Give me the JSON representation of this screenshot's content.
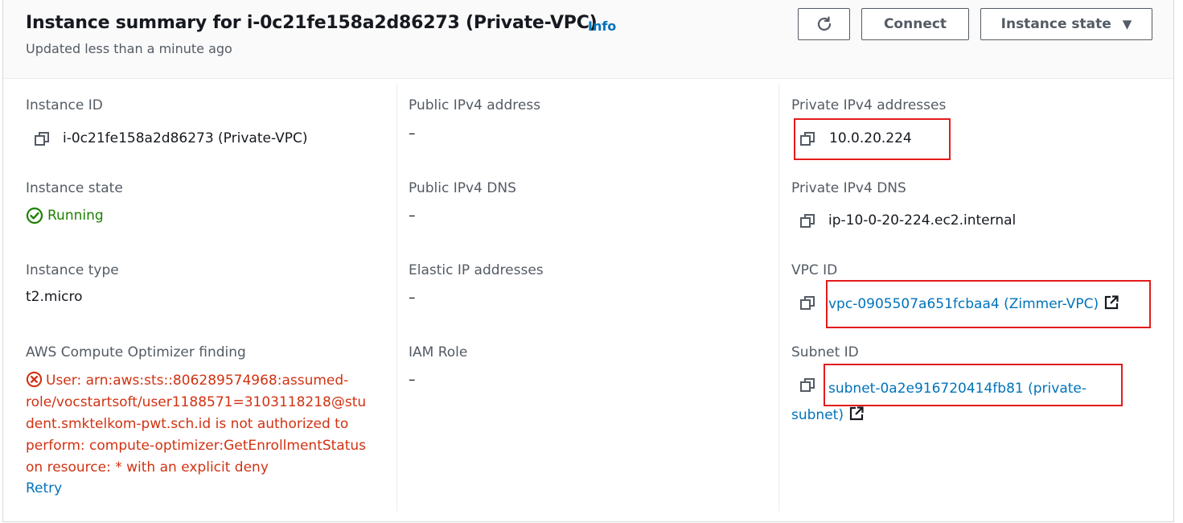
{
  "header": {
    "title": "Instance summary for i-0c21fe158a2d86273 (Private-VPC)",
    "info_label": "Info",
    "updated_text": "Updated less than a minute ago",
    "connect_label": "Connect",
    "instance_state_label": "Instance state"
  },
  "fields": {
    "instance_id": {
      "label": "Instance ID",
      "value": "i-0c21fe158a2d86273 (Private-VPC)"
    },
    "instance_state": {
      "label": "Instance state",
      "value": "Running"
    },
    "instance_type": {
      "label": "Instance type",
      "value": "t2.micro"
    },
    "compute_optimizer": {
      "label": "AWS Compute Optimizer finding",
      "error_lines": [
        "User: arn:aws:sts::806289574968:assumed-",
        "role/vocstartsoft/user1188571=3103118218@stu",
        "dent.smktelkom-pwt.sch.id is not authorized to",
        "perform: compute-optimizer:GetEnrollmentStatus",
        "on resource: * with an explicit deny"
      ],
      "retry_label": "Retry"
    },
    "public_ipv4_address": {
      "label": "Public IPv4 address",
      "value": "–"
    },
    "public_ipv4_dns": {
      "label": "Public IPv4 DNS",
      "value": "–"
    },
    "elastic_ip": {
      "label": "Elastic IP addresses",
      "value": "–"
    },
    "iam_role": {
      "label": "IAM Role",
      "value": "–"
    },
    "private_ipv4_addresses": {
      "label": "Private IPv4 addresses",
      "value": "10.0.20.224"
    },
    "private_ipv4_dns": {
      "label": "Private IPv4 DNS",
      "value": "ip-10-0-20-224.ec2.internal"
    },
    "vpc_id": {
      "label": "VPC ID",
      "value": "vpc-0905507a651fcbaa4 (Zimmer-VPC)"
    },
    "subnet_id": {
      "label": "Subnet ID",
      "value_line1": "subnet-0a2e916720414fb81 (private-",
      "value_line2": "subnet)"
    }
  },
  "icons": {
    "refresh": "refresh-icon",
    "caret": "caret-down-icon",
    "copy": "copy-icon",
    "external": "external-link-icon",
    "status_ok": "check-circle-icon",
    "status_error": "x-circle-icon"
  },
  "colors": {
    "link": "#0073bb",
    "success": "#1d8102",
    "error": "#d13212",
    "annotation_box": "#e31b1b"
  }
}
